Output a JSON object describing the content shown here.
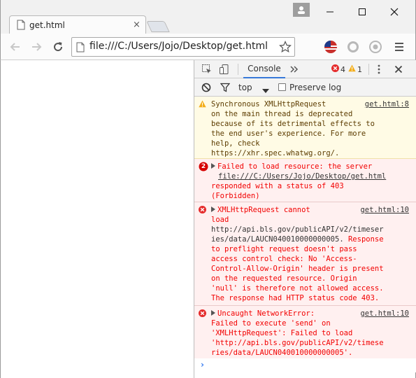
{
  "browser": {
    "tab_title": "get.html",
    "tab_close": "×",
    "url": "file:///C:/Users/Jojo/Desktop/get.html"
  },
  "devtools": {
    "console_tab": "Console",
    "error_count": "4",
    "warning_count": "1",
    "context": "top",
    "preserve_log": "Preserve log",
    "messages": [
      {
        "type": "warning",
        "source": "get.html:8",
        "lines": [
          "Synchronous XMLHttpRequest",
          "on the main thread is deprecated",
          "because of its detrimental effects to",
          "the end user's experience. For more",
          "help, check",
          "https://xhr.spec.whatwg.org/."
        ]
      },
      {
        "type": "error",
        "badge": "2",
        "line1": "Failed to load resource: the server",
        "line2": "file:///C:/Users/Jojo/Desktop/get.html",
        "lines": [
          "responded with a status of 403",
          "(Forbidden)"
        ]
      },
      {
        "type": "error",
        "source": "get.html:10",
        "line1": "XMLHttpRequest cannot",
        "lines": [
          "load"
        ],
        "url_lines": [
          "http://api.bls.gov/publicAPI/v2/timeser",
          "ies/data/LAUCN040010000000005."
        ],
        "tail_first": " Response",
        "tail": [
          "to preflight request doesn't pass",
          "access control check: No 'Access-",
          "Control-Allow-Origin' header is present",
          "on the requested resource. Origin",
          "'null' is therefore not allowed access.",
          "The response had HTTP status code 403."
        ]
      },
      {
        "type": "error",
        "source": "get.html:10",
        "line1": "Uncaught NetworkError:",
        "lines": [
          "Failed to execute 'send' on",
          "'XMLHttpRequest': Failed to load",
          "'http://api.bls.gov/publicAPI/v2/timese",
          "ries/data/LAUCN040010000000005'."
        ]
      }
    ]
  },
  "colors": {
    "error_text": "#f20000",
    "warning_bg": "#fffbe5",
    "error_bg": "#fff0f0",
    "accent": "#3879d9"
  }
}
